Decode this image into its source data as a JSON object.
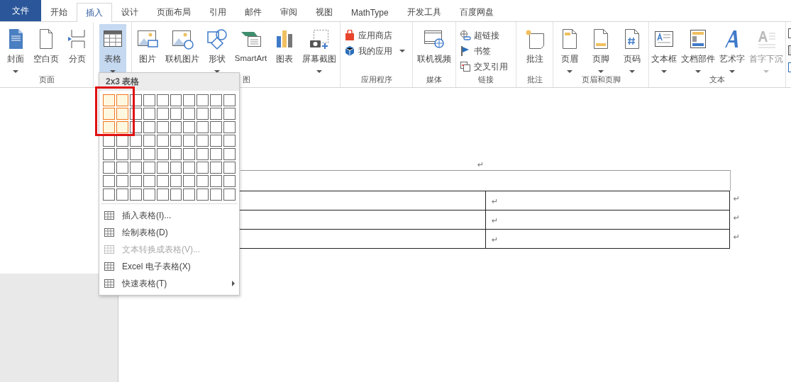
{
  "tabs": [
    {
      "label": "文件",
      "kind": "file",
      "selected": false
    },
    {
      "label": "开始",
      "kind": "tab",
      "selected": false
    },
    {
      "label": "插入",
      "kind": "tab",
      "selected": true
    },
    {
      "label": "设计",
      "kind": "tab",
      "selected": false
    },
    {
      "label": "页面布局",
      "kind": "tab",
      "selected": false
    },
    {
      "label": "引用",
      "kind": "tab",
      "selected": false
    },
    {
      "label": "邮件",
      "kind": "tab",
      "selected": false
    },
    {
      "label": "审阅",
      "kind": "tab",
      "selected": false
    },
    {
      "label": "视图",
      "kind": "tab",
      "selected": false
    },
    {
      "label": "MathType",
      "kind": "tab",
      "selected": false
    },
    {
      "label": "开发工具",
      "kind": "tab",
      "selected": false
    },
    {
      "label": "百度网盘",
      "kind": "tab",
      "selected": false
    }
  ],
  "ribbon_groups": [
    {
      "label": "页面",
      "buttons": [
        {
          "label": "封面",
          "kind": "large",
          "has_menu": true,
          "selected": false,
          "disabled": false
        },
        {
          "label": "空白页",
          "kind": "large",
          "has_menu": false,
          "selected": false,
          "disabled": false
        },
        {
          "label": "分页",
          "kind": "large",
          "has_menu": false,
          "selected": false,
          "disabled": false
        }
      ]
    },
    {
      "buttons": [
        {
          "label": "表格",
          "kind": "large",
          "has_menu": true,
          "selected": true,
          "disabled": false
        }
      ]
    },
    {
      "label": "图",
      "buttons": [
        {
          "label": "图片",
          "kind": "large",
          "has_menu": false,
          "selected": false,
          "disabled": false
        },
        {
          "label": "联机图片",
          "kind": "large",
          "has_menu": false,
          "selected": false,
          "disabled": false
        },
        {
          "label": "形状",
          "kind": "large",
          "has_menu": true,
          "selected": false,
          "disabled": false
        },
        {
          "label": "SmartArt",
          "kind": "large",
          "has_menu": false,
          "selected": false,
          "disabled": false
        },
        {
          "label": "图表",
          "kind": "large",
          "has_menu": false,
          "selected": false,
          "disabled": false
        },
        {
          "label": "屏幕截图",
          "kind": "large",
          "has_menu": true,
          "selected": false,
          "disabled": false
        }
      ]
    },
    {
      "label": "应用程序",
      "buttons": [
        {
          "label": "应用商店",
          "kind": "small",
          "has_menu": false
        },
        {
          "label": "我的应用",
          "kind": "small",
          "has_menu": true
        }
      ]
    },
    {
      "label": "媒体",
      "buttons": [
        {
          "label": "联机视频",
          "kind": "large",
          "has_menu": false,
          "selected": false,
          "disabled": false
        }
      ]
    },
    {
      "label": "链接",
      "buttons": [
        {
          "label": "超链接",
          "kind": "small",
          "has_menu": false
        },
        {
          "label": "书签",
          "kind": "small",
          "has_menu": false
        },
        {
          "label": "交叉引用",
          "kind": "small",
          "has_menu": false
        }
      ]
    },
    {
      "label": "批注",
      "buttons": [
        {
          "label": "批注",
          "kind": "large",
          "has_menu": false,
          "selected": false,
          "disabled": false
        }
      ]
    },
    {
      "label": "页眉和页脚",
      "buttons": [
        {
          "label": "页眉",
          "kind": "large",
          "has_menu": true,
          "selected": false,
          "disabled": false
        },
        {
          "label": "页脚",
          "kind": "large",
          "has_menu": true,
          "selected": false,
          "disabled": false
        },
        {
          "label": "页码",
          "kind": "large",
          "has_menu": true,
          "selected": false,
          "disabled": false
        }
      ]
    },
    {
      "label": "文本",
      "buttons": [
        {
          "label": "文本框",
          "kind": "large",
          "has_menu": true,
          "selected": false,
          "disabled": false
        },
        {
          "label": "文档部件",
          "kind": "large",
          "has_menu": true,
          "selected": false,
          "disabled": false
        },
        {
          "label": "艺术字",
          "kind": "large",
          "has_menu": true,
          "selected": false,
          "disabled": false
        },
        {
          "label": "首字下沉",
          "kind": "large",
          "has_menu": true,
          "selected": false,
          "disabled": true
        }
      ]
    }
  ],
  "table_menu": {
    "header": "2x3 表格",
    "grid_rows": [
      [
        {
          "selected": true
        },
        {
          "selected": true
        },
        {
          "selected": false
        },
        {
          "selected": false
        },
        {
          "selected": false
        },
        {
          "selected": false
        },
        {
          "selected": false
        },
        {
          "selected": false
        },
        {
          "selected": false
        },
        {
          "selected": false
        }
      ],
      [
        {
          "selected": true
        },
        {
          "selected": true
        },
        {
          "selected": false
        },
        {
          "selected": false
        },
        {
          "selected": false
        },
        {
          "selected": false
        },
        {
          "selected": false
        },
        {
          "selected": false
        },
        {
          "selected": false
        },
        {
          "selected": false
        }
      ],
      [
        {
          "selected": true
        },
        {
          "selected": true
        },
        {
          "selected": false
        },
        {
          "selected": false
        },
        {
          "selected": false
        },
        {
          "selected": false
        },
        {
          "selected": false
        },
        {
          "selected": false
        },
        {
          "selected": false
        },
        {
          "selected": false
        }
      ],
      [
        {
          "selected": false
        },
        {
          "selected": false
        },
        {
          "selected": false
        },
        {
          "selected": false
        },
        {
          "selected": false
        },
        {
          "selected": false
        },
        {
          "selected": false
        },
        {
          "selected": false
        },
        {
          "selected": false
        },
        {
          "selected": false
        }
      ],
      [
        {
          "selected": false
        },
        {
          "selected": false
        },
        {
          "selected": false
        },
        {
          "selected": false
        },
        {
          "selected": false
        },
        {
          "selected": false
        },
        {
          "selected": false
        },
        {
          "selected": false
        },
        {
          "selected": false
        },
        {
          "selected": false
        }
      ],
      [
        {
          "selected": false
        },
        {
          "selected": false
        },
        {
          "selected": false
        },
        {
          "selected": false
        },
        {
          "selected": false
        },
        {
          "selected": false
        },
        {
          "selected": false
        },
        {
          "selected": false
        },
        {
          "selected": false
        },
        {
          "selected": false
        }
      ],
      [
        {
          "selected": false
        },
        {
          "selected": false
        },
        {
          "selected": false
        },
        {
          "selected": false
        },
        {
          "selected": false
        },
        {
          "selected": false
        },
        {
          "selected": false
        },
        {
          "selected": false
        },
        {
          "selected": false
        },
        {
          "selected": false
        }
      ],
      [
        {
          "selected": false
        },
        {
          "selected": false
        },
        {
          "selected": false
        },
        {
          "selected": false
        },
        {
          "selected": false
        },
        {
          "selected": false
        },
        {
          "selected": false
        },
        {
          "selected": false
        },
        {
          "selected": false
        },
        {
          "selected": false
        }
      ]
    ],
    "items": [
      {
        "label": "插入表格(I)...",
        "disabled": false,
        "has_submenu": false
      },
      {
        "label": "绘制表格(D)",
        "disabled": false,
        "has_submenu": false
      },
      {
        "label": "文本转换成表格(V)...",
        "disabled": true,
        "has_submenu": false
      },
      {
        "label": "Excel 电子表格(X)",
        "disabled": false,
        "has_submenu": false
      },
      {
        "label": "快速表格(T)",
        "disabled": false,
        "has_submenu": true
      }
    ]
  },
  "document": {
    "paragraph_mark": "↵",
    "table_rows": [
      {
        "cell_mark": "↵",
        "row_end_mark": "↵"
      },
      {
        "cell_mark": "↵",
        "row_end_mark": "↵"
      },
      {
        "cell_mark": "↵",
        "row_end_mark": "↵"
      }
    ]
  }
}
